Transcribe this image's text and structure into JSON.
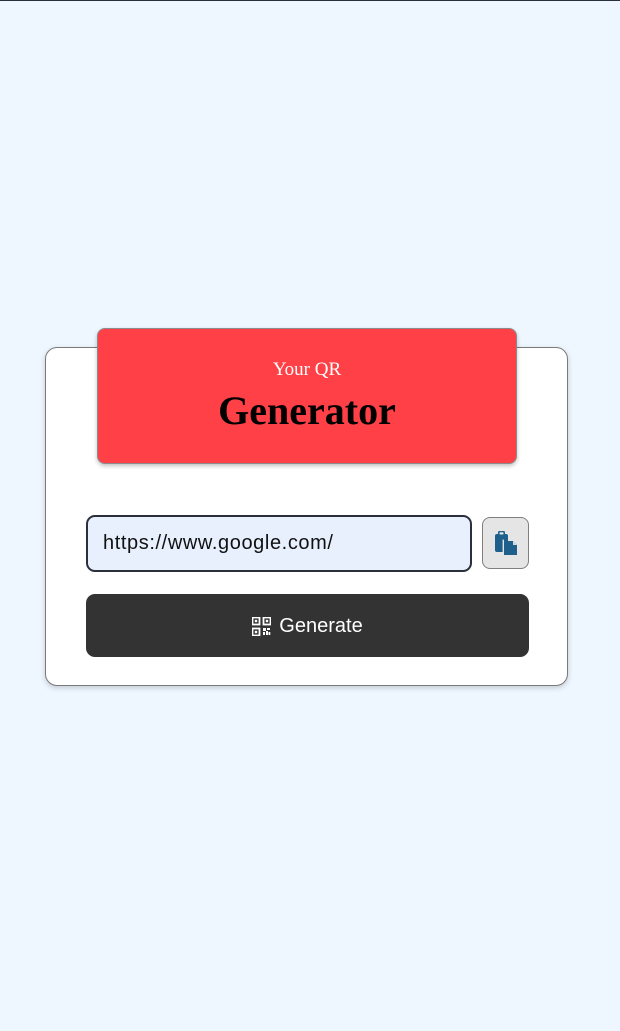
{
  "header": {
    "subtitle": "Your QR",
    "title": "Generator"
  },
  "form": {
    "url_value": "https://www.google.com/",
    "generate_label": "Generate"
  },
  "icons": {
    "paste": "clipboard-paste-icon",
    "generate": "qr-code-icon"
  },
  "colors": {
    "page_background": "#eef6ff",
    "banner": "#ff4046",
    "input_background": "#e8f0fe",
    "generate_button": "#333333",
    "paste_icon": "#1f5f8b"
  }
}
